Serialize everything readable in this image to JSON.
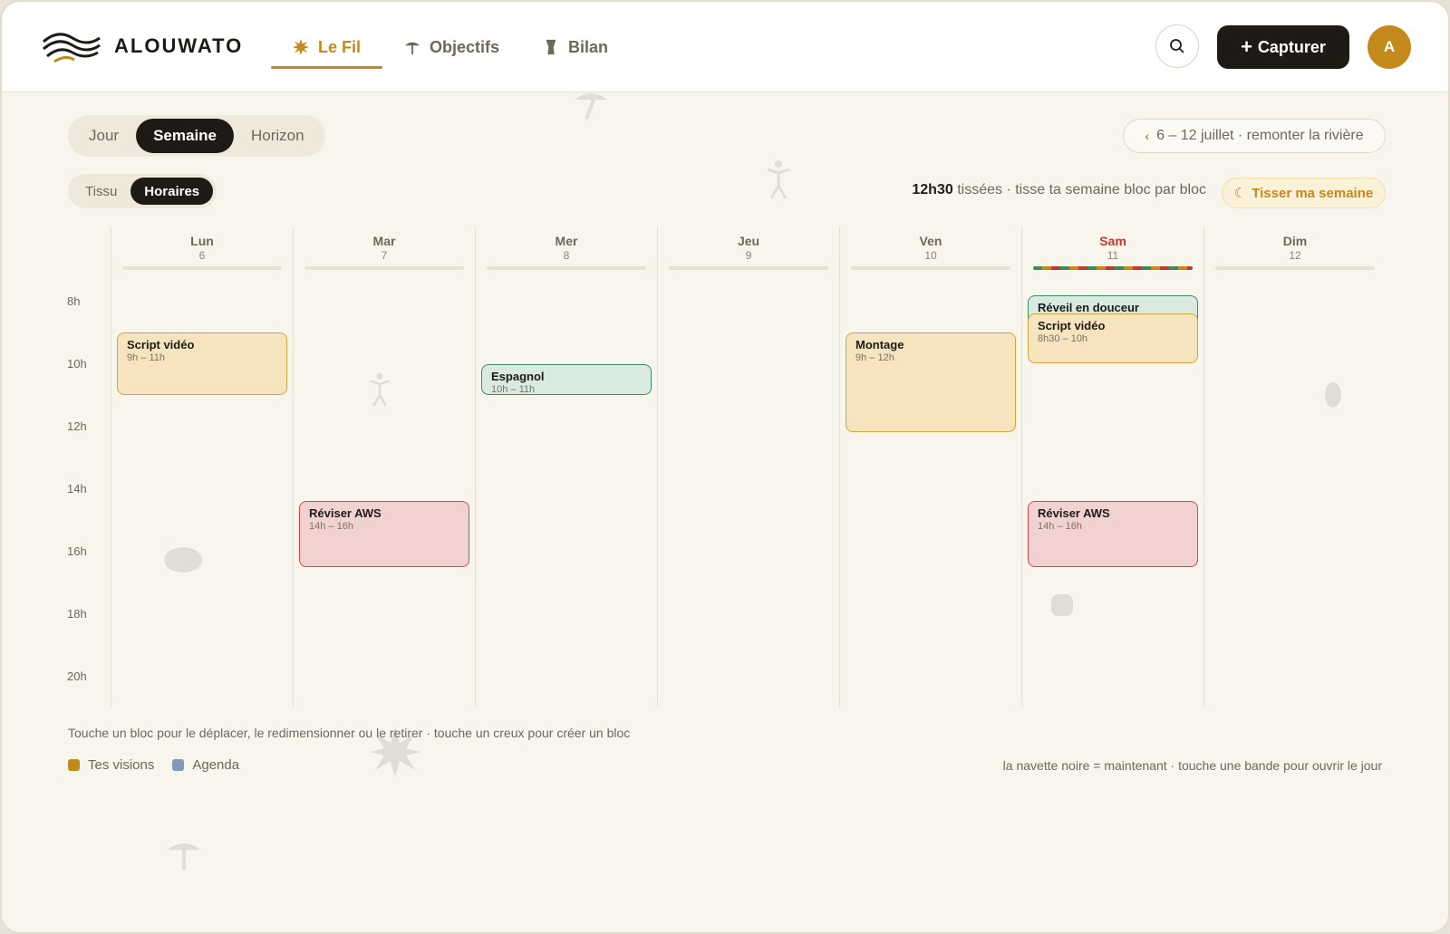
{
  "brand": {
    "name": "ALOUWATO"
  },
  "nav": [
    {
      "label": "Le Fil",
      "icon": "sun-icon",
      "active": true
    },
    {
      "label": "Objectifs",
      "icon": "umbrella-icon",
      "active": false
    },
    {
      "label": "Bilan",
      "icon": "drum-icon",
      "active": false
    }
  ],
  "header": {
    "capture_label": "Capturer",
    "avatar_initial": "A"
  },
  "view_switch": {
    "options": [
      "Jour",
      "Semaine",
      "Horizon"
    ],
    "selected": "Semaine"
  },
  "mode_switch": {
    "options": [
      "Tissu",
      "Horaires"
    ],
    "selected": "Horaires"
  },
  "week": {
    "range_label": "6 – 12 juillet · remonter la rivière"
  },
  "summary": {
    "total": "12h30",
    "text": "tissées · tisse ta semaine bloc par bloc"
  },
  "weave_button": {
    "label": "Tisser ma semaine"
  },
  "hours": [
    "8h",
    "10h",
    "12h",
    "14h",
    "16h",
    "18h",
    "20h"
  ],
  "days": [
    {
      "name": "Lun",
      "num": "6",
      "today": false
    },
    {
      "name": "Mar",
      "num": "7",
      "today": false
    },
    {
      "name": "Mer",
      "num": "8",
      "today": false
    },
    {
      "name": "Jeu",
      "num": "9",
      "today": false
    },
    {
      "name": "Ven",
      "num": "10",
      "today": false
    },
    {
      "name": "Sam",
      "num": "11",
      "today": true
    },
    {
      "name": "Dim",
      "num": "12",
      "today": false
    }
  ],
  "events": [
    {
      "day": 0,
      "title": "Script vidéo",
      "time": "9h – 11h",
      "start": 9,
      "end": 11,
      "kind": "yellow"
    },
    {
      "day": 1,
      "title": "Réviser AWS",
      "time": "14h – 16h",
      "start": 14.4,
      "end": 16.5,
      "kind": "red"
    },
    {
      "day": 2,
      "title": "Espagnol",
      "time": "10h – 11h",
      "start": 10,
      "end": 11,
      "kind": "green"
    },
    {
      "day": 4,
      "title": "Montage",
      "time": "9h – 12h",
      "start": 9,
      "end": 12.2,
      "kind": "yellow"
    },
    {
      "day": 5,
      "title": "Réveil en douceur",
      "time": "",
      "start": 7.8,
      "end": 9.2,
      "kind": "green"
    },
    {
      "day": 5,
      "title": "Script vidéo",
      "time": "8h30 – 10h",
      "start": 8.4,
      "end": 10,
      "kind": "yellow"
    },
    {
      "day": 5,
      "title": "Réviser AWS",
      "time": "14h – 16h",
      "start": 14.4,
      "end": 16.5,
      "kind": "red"
    }
  ],
  "footer": {
    "hint": "Touche un bloc pour le déplacer, le redimensionner ou le retirer · touche un creux pour créer un bloc",
    "legend": [
      {
        "label": "Tes visions",
        "color": "#c4891b"
      },
      {
        "label": "Agenda",
        "color": "#7f9bb5"
      }
    ],
    "note": "la navette noire = maintenant · touche une bande pour ouvrir le jour"
  },
  "colors": {
    "accent": "#c4891b",
    "dark": "#1e1b17",
    "today": "#c13a2f"
  }
}
